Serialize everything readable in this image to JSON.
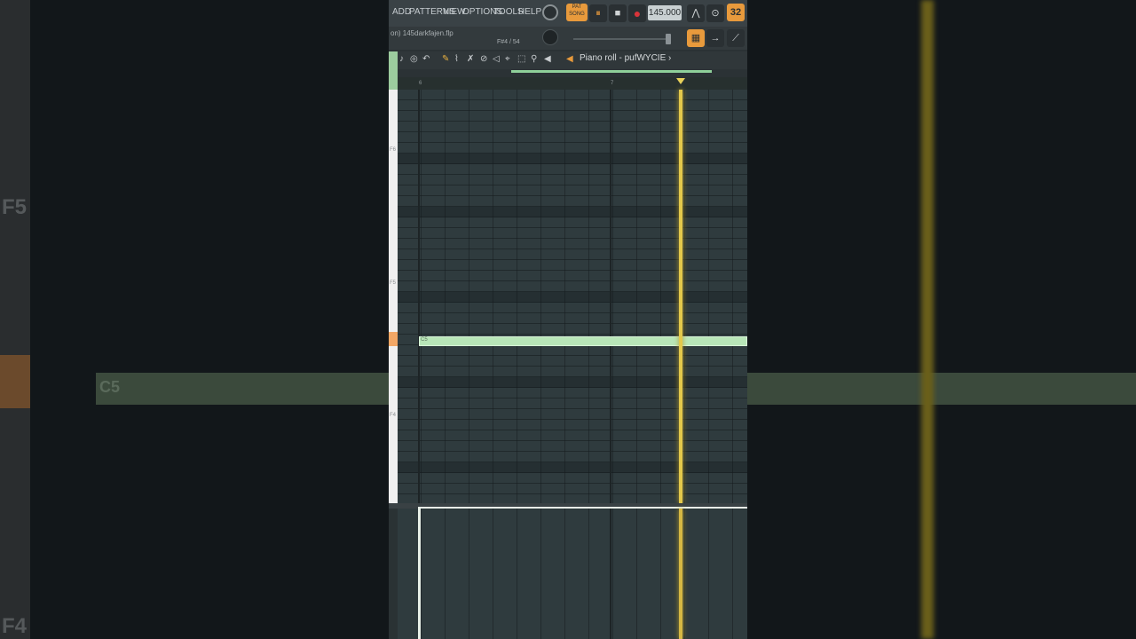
{
  "menu": {
    "items": [
      "ADD",
      "PATTERNS",
      "VIEW",
      "OPTIONS",
      "TOOLS",
      "HELP"
    ]
  },
  "transport": {
    "mode_label": "PAT",
    "mode_sub": "SONG",
    "tempo": "145.000",
    "pattern_number": "32"
  },
  "project": {
    "file_name": "on) 145darkfajen.flp",
    "position": "F#4 / 54"
  },
  "piano_roll": {
    "title": "Piano roll - pufWYCIE",
    "title_chevron": "›",
    "ruler_labels": [
      "6",
      "7"
    ],
    "key_labels": [
      "F6",
      "F5",
      "F4"
    ],
    "note_label": "C5"
  },
  "background": {
    "left_label": "F5",
    "left_bottom_label": "F4",
    "note_label": "C5"
  },
  "colors": {
    "note": "#b8e6b8",
    "playline": "#e3c84b",
    "accent_orange": "#f2a765"
  }
}
